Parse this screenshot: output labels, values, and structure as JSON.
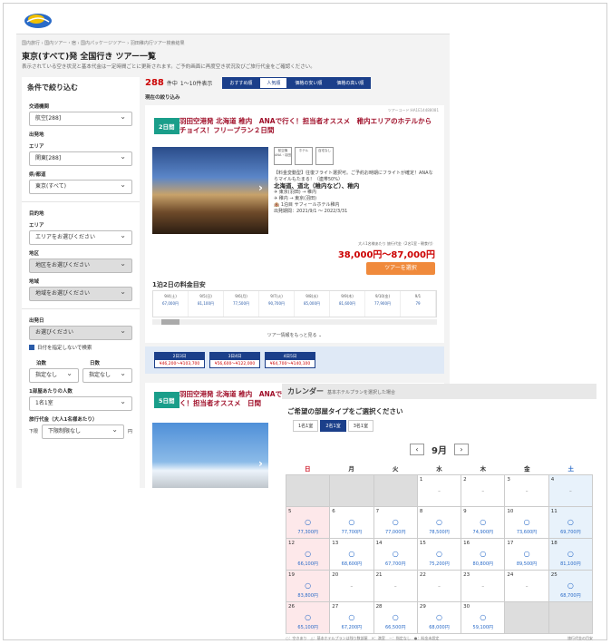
{
  "breadcrumb": "国内旅行 › 国内ツアー・宿 › 国内パッケージツアー › 羽田稚内行ツアー検索結果",
  "title": "東京(すべて)発 全国行き ツアー一覧",
  "note": "表示されている空き状況と基本代金は一定時間ごとに更新されます。ご予約画面に再度空き状況及びご旅行代金をご確認ください。",
  "sidebar": {
    "title": "条件で絞り込む",
    "f1_label": "交通機関",
    "f1_val": "航空[288]",
    "f2_head": "出発地",
    "f2_label": "エリア",
    "f2_val": "関東[288]",
    "f3_label": "県/都道",
    "f3_val": "東京(すべて)",
    "f4_head": "目的地",
    "f4_label": "エリア",
    "f4_val": "エリアをお選びください",
    "f5_label": "地区",
    "f5_val": "地区をお選びください",
    "f6_label": "地域",
    "f6_val": "地域をお選びください",
    "f7_label": "出発日",
    "f7_val": "お選びください",
    "chk": "日付を指定しないで検索",
    "f8a_label": "泊数",
    "f8a_val": "指定なし",
    "f8b_label": "日数",
    "f8b_val": "指定なし",
    "f9_label": "1部屋あたりの人数",
    "f9_val": "1名1室",
    "f10_label": "旅行代金（大人1名様あたり）",
    "f10_pre": "下限",
    "f10_val": "下限制限なし",
    "f10_unit": "円"
  },
  "count": "288",
  "count_unit": "件中",
  "count_range": "1〜10件表示",
  "sorts": [
    "おすすめ順",
    "人気順",
    "価格の安い順",
    "価格の高い順"
  ],
  "sub": "現在の絞り込み",
  "card1": {
    "badge": "2日間",
    "title": "羽田空港発 北海道 稚内　ANAで行く！担当者オススメ　稚内エリアのホテルからチョイス！フリープラン２日間",
    "code": "ツアーコード:HA1E14488081",
    "icons": [
      "航空機 ANA・羽田",
      "ホテル",
      "自宅なし"
    ],
    "d1": "【料金変動型】往復フライト選択可。ご予約お時期にフライトが確定！ANAならマイルもたまる！（連帯50%）",
    "d2": "北海道、道北（稚内など）、稚内",
    "d3": "✈ 東京(羽田) → 稚内",
    "d4": "✈ 稚内 → 東京(羽田)",
    "d5": "🏨 1泊目 サフィールホテル稚内",
    "d6": "出発期間：2021/9/1 〜 2022/3/31",
    "price_note": "大人1名様あたり 旅行代金（2名1室・朝食付）",
    "price": "38,000円〜87,000円",
    "button": "ツアーを選択",
    "gtitle": "1泊2日の料金目安",
    "grid": [
      [
        "9/4(土)",
        "67,000円"
      ],
      [
        "9/5(日)",
        "81,100円"
      ],
      [
        "9/6(月)",
        "77,500円"
      ],
      [
        "9/7(火)",
        "90,700円"
      ],
      [
        "9/8(水)",
        "85,000円"
      ],
      [
        "9/9(木)",
        "81,600円"
      ],
      [
        "9/10(金)",
        "77,900円"
      ],
      [
        "9/1",
        "79"
      ]
    ],
    "more": "ツアー情報をもっと見る ⌄"
  },
  "days": [
    [
      "2日3日",
      "¥46,200〜¥103,700"
    ],
    [
      "3日4日",
      "¥56,600〜¥122,000"
    ],
    [
      "4日5日",
      "¥64,700〜¥140,100"
    ]
  ],
  "card2": {
    "badge": "5日間",
    "title": "羽田空港発 北海道 稚内　ANAで行く！担当者オススメ　日間"
  },
  "calendar": {
    "title": "カレンダー",
    "title_note": "基本ホテルプランを選択した場合",
    "question": "ご希望の部屋タイプをご選択ください",
    "rooms": [
      "1名1室",
      "2名1室",
      "3名1室"
    ],
    "month": "9月",
    "week": [
      "日",
      "月",
      "火",
      "水",
      "木",
      "金",
      "土"
    ],
    "cells": [
      [
        "",
        "",
        ""
      ],
      [
        "",
        "",
        ""
      ],
      [
        "",
        "",
        ""
      ],
      [
        "1",
        "",
        ""
      ],
      [
        "2",
        "",
        ""
      ],
      [
        "3",
        "",
        ""
      ],
      [
        "4",
        "",
        ""
      ],
      [
        "5",
        "○",
        "77,300円"
      ],
      [
        "6",
        "○",
        "77,700円"
      ],
      [
        "7",
        "○",
        "77,000円"
      ],
      [
        "8",
        "○",
        "78,500円"
      ],
      [
        "9",
        "○",
        "74,900円"
      ],
      [
        "10",
        "○",
        "73,600円"
      ],
      [
        "11",
        "○",
        "69,700円"
      ],
      [
        "12",
        "○",
        "66,100円"
      ],
      [
        "13",
        "○",
        "68,600円"
      ],
      [
        "14",
        "○",
        "67,700円"
      ],
      [
        "15",
        "○",
        "75,200円"
      ],
      [
        "16",
        "○",
        "80,800円"
      ],
      [
        "17",
        "○",
        "89,500円"
      ],
      [
        "18",
        "○",
        "81,100円"
      ],
      [
        "19",
        "○",
        "83,800円"
      ],
      [
        "20",
        "",
        ""
      ],
      [
        "21",
        "",
        ""
      ],
      [
        "22",
        "",
        ""
      ],
      [
        "23",
        "",
        ""
      ],
      [
        "24",
        "",
        ""
      ],
      [
        "25",
        "○",
        "68,700円"
      ],
      [
        "26",
        "○",
        "65,100円"
      ],
      [
        "27",
        "○",
        "67,200円"
      ],
      [
        "28",
        "○",
        "66,500円"
      ],
      [
        "29",
        "○",
        "68,000円"
      ],
      [
        "30",
        "○",
        "59,100円"
      ],
      [
        "",
        "",
        ""
      ],
      [
        "",
        "",
        ""
      ]
    ],
    "legend": "○：空きあり　△：基本ホテルプランは残り数部屋　×：満室　－：指定なし　●：料金未設定",
    "legend2": "旅行代金の目安"
  }
}
